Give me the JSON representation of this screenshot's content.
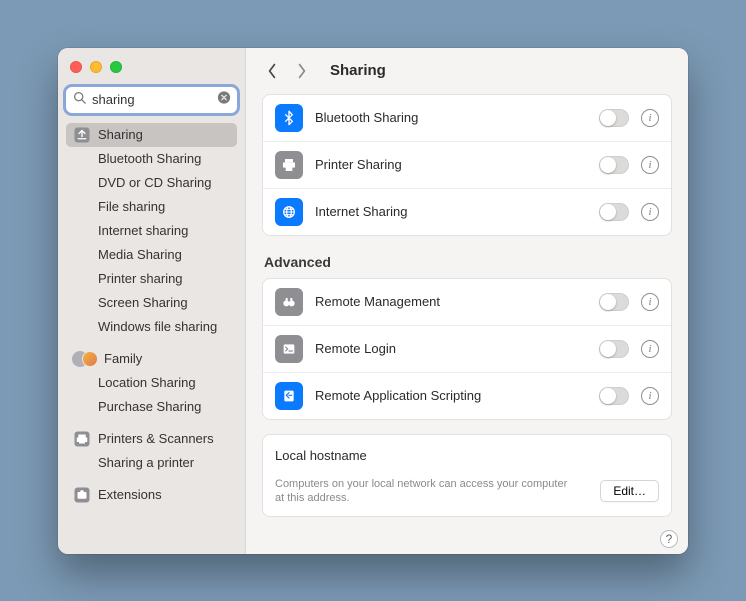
{
  "search": {
    "value": "sharing"
  },
  "sidebar": {
    "items": [
      {
        "label": "Sharing"
      },
      {
        "label": "Bluetooth Sharing"
      },
      {
        "label": "DVD or CD Sharing"
      },
      {
        "label": "File sharing"
      },
      {
        "label": "Internet sharing"
      },
      {
        "label": "Media Sharing"
      },
      {
        "label": "Printer sharing"
      },
      {
        "label": "Screen Sharing"
      },
      {
        "label": "Windows file sharing"
      },
      {
        "label": "Family"
      },
      {
        "label": "Location Sharing"
      },
      {
        "label": "Purchase Sharing"
      },
      {
        "label": "Printers & Scanners"
      },
      {
        "label": "Sharing a printer"
      },
      {
        "label": "Extensions"
      }
    ]
  },
  "toolbar": {
    "title": "Sharing"
  },
  "groupA": [
    {
      "label": "Bluetooth Sharing"
    },
    {
      "label": "Printer Sharing"
    },
    {
      "label": "Internet Sharing"
    }
  ],
  "advanced_heading": "Advanced",
  "groupB": [
    {
      "label": "Remote Management"
    },
    {
      "label": "Remote Login"
    },
    {
      "label": "Remote Application Scripting"
    }
  ],
  "hostname": {
    "label": "Local hostname",
    "desc": "Computers on your local network can access your computer at this address.",
    "edit": "Edit…"
  },
  "help": "?"
}
